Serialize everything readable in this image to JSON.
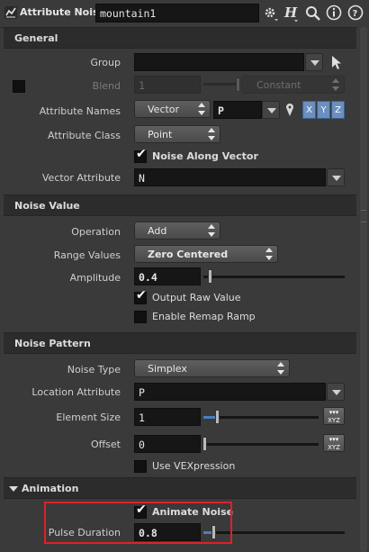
{
  "header": {
    "node_type": "Attribute Noise",
    "node_name": "mountain1"
  },
  "sections": {
    "general": "General",
    "noise_value": "Noise Value",
    "noise_pattern": "Noise Pattern",
    "animation": "Animation"
  },
  "general": {
    "group_label": "Group",
    "group_value": "",
    "blend_label": "Blend",
    "blend_value": "1",
    "blend_mode": "Constant",
    "attr_names_label": "Attribute Names",
    "attr_type": "Vector",
    "attr_name": "P",
    "components": [
      "X",
      "Y",
      "Z"
    ],
    "attr_class_label": "Attribute Class",
    "attr_class": "Point",
    "noise_along_vector": "Noise Along Vector",
    "vector_attr_label": "Vector Attribute",
    "vector_attr_value": "N"
  },
  "noise_value": {
    "operation_label": "Operation",
    "operation": "Add",
    "range_label": "Range Values",
    "range": "Zero Centered",
    "amplitude_label": "Amplitude",
    "amplitude": "0.4",
    "output_raw": "Output Raw Value",
    "enable_remap": "Enable Remap Ramp"
  },
  "noise_pattern": {
    "noise_type_label": "Noise Type",
    "noise_type": "Simplex",
    "location_label": "Location Attribute",
    "location_value": "P",
    "element_size_label": "Element Size",
    "element_size": "1",
    "offset_label": "Offset",
    "offset": "0",
    "use_vex": "Use VEXpression"
  },
  "animation": {
    "animate_noise": "Animate Noise",
    "pulse_label": "Pulse Duration",
    "pulse_value": "0.8"
  },
  "xyz_label": "XYZ",
  "colors": {
    "highlight_box": "#e0202a",
    "accent_blue": "#4a7fbf",
    "background": "#3a3a3a"
  }
}
